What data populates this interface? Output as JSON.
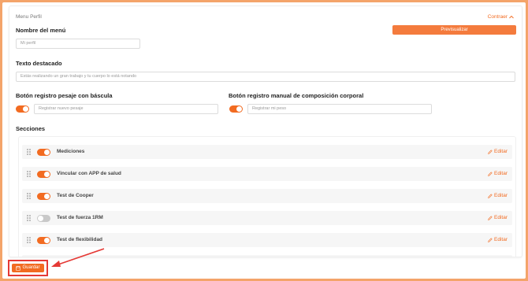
{
  "panel": {
    "title": "Menu Perfil",
    "collapse_label": "Contraer",
    "menu_name_label": "Nombre del menú",
    "menu_name_value": "Mi perfil",
    "preview_label": "Previsualizar",
    "highlight_label": "Texto destacado",
    "highlight_value": "Estás realizando un gran trabajo y tu cuerpo lo está notando",
    "scale_label": "Botón registro pesaje con báscula",
    "scale_input": "Registrar nuevo pesaje",
    "manual_label": "Botón registro manual de composición corporal",
    "manual_input": "Registrar mi peso",
    "sections_label": "Secciones"
  },
  "sections": [
    {
      "label": "Mediciones",
      "enabled": true,
      "edit": "Editar"
    },
    {
      "label": "Vincular con APP de salud",
      "enabled": true,
      "edit": "Editar"
    },
    {
      "label": "Test de Cooper",
      "enabled": true,
      "edit": "Editar"
    },
    {
      "label": "Test de fuerza 1RM",
      "enabled": false,
      "edit": "Editar"
    },
    {
      "label": "Test de flexibilidad",
      "enabled": true,
      "edit": "Editar"
    }
  ],
  "footer": {
    "save_label": "Guardar"
  },
  "colors": {
    "accent": "#f26b21",
    "highlight_border": "#e53935",
    "frame": "#f4a46a"
  }
}
